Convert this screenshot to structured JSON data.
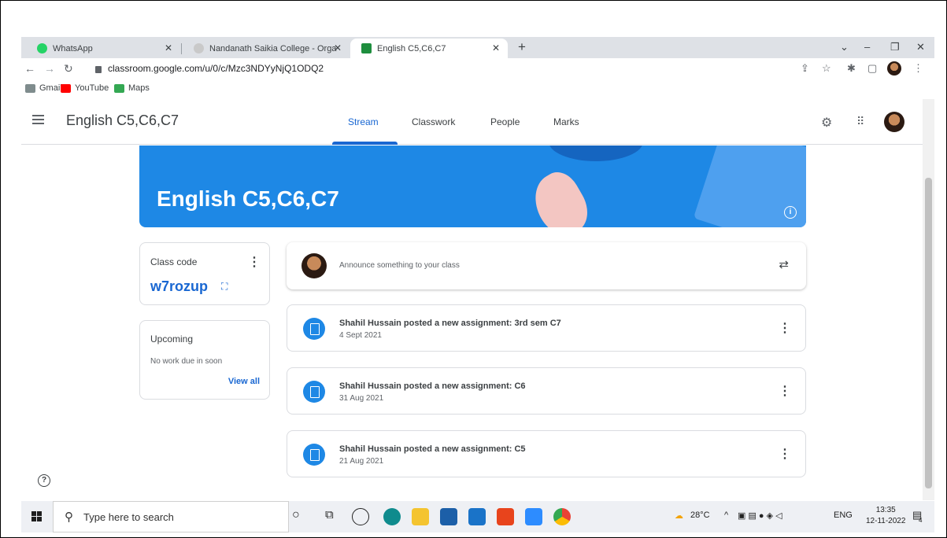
{
  "browser": {
    "tabs": [
      {
        "label": "WhatsApp",
        "icon": "whatsapp-icon"
      },
      {
        "label": "Nandanath Saikia College - Orga",
        "icon": "college-icon"
      },
      {
        "label": "English C5,C6,C7",
        "icon": "classroom-icon",
        "active": true
      }
    ],
    "url": "classroom.google.com/u/0/c/Mzc3NDYyNjQ1ODQ2",
    "bookmarks": [
      {
        "label": "Gmail",
        "icon": "gmail-icon"
      },
      {
        "label": "YouTube",
        "icon": "youtube-icon"
      },
      {
        "label": "Maps",
        "icon": "maps-icon"
      }
    ]
  },
  "classroom": {
    "title": "English C5,C6,C7",
    "nav_tabs": [
      "Stream",
      "Classwork",
      "People",
      "Marks"
    ],
    "active_tab": "Stream",
    "banner_title": "English C5,C6,C7",
    "class_code": {
      "label": "Class code",
      "value": "w7rozup"
    },
    "upcoming": {
      "title": "Upcoming",
      "empty_text": "No work due in soon",
      "view_all": "View all"
    },
    "announce_placeholder": "Announce something to your class",
    "posts": [
      {
        "title": "Shahil Hussain posted a new assignment: 3rd sem C7",
        "date": "4 Sept 2021"
      },
      {
        "title": "Shahil Hussain posted a new assignment: C6",
        "date": "31 Aug 2021"
      },
      {
        "title": "Shahil Hussain posted a new assignment: C5",
        "date": "21 Aug 2021"
      }
    ]
  },
  "taskbar": {
    "search_placeholder": "Type here to search",
    "weather": "28°C",
    "language": "ENG",
    "time": "13:35",
    "date": "12-11-2022",
    "notification_count": "4"
  },
  "colors": {
    "accent": "#1967d2",
    "banner": "#1e88e5"
  }
}
